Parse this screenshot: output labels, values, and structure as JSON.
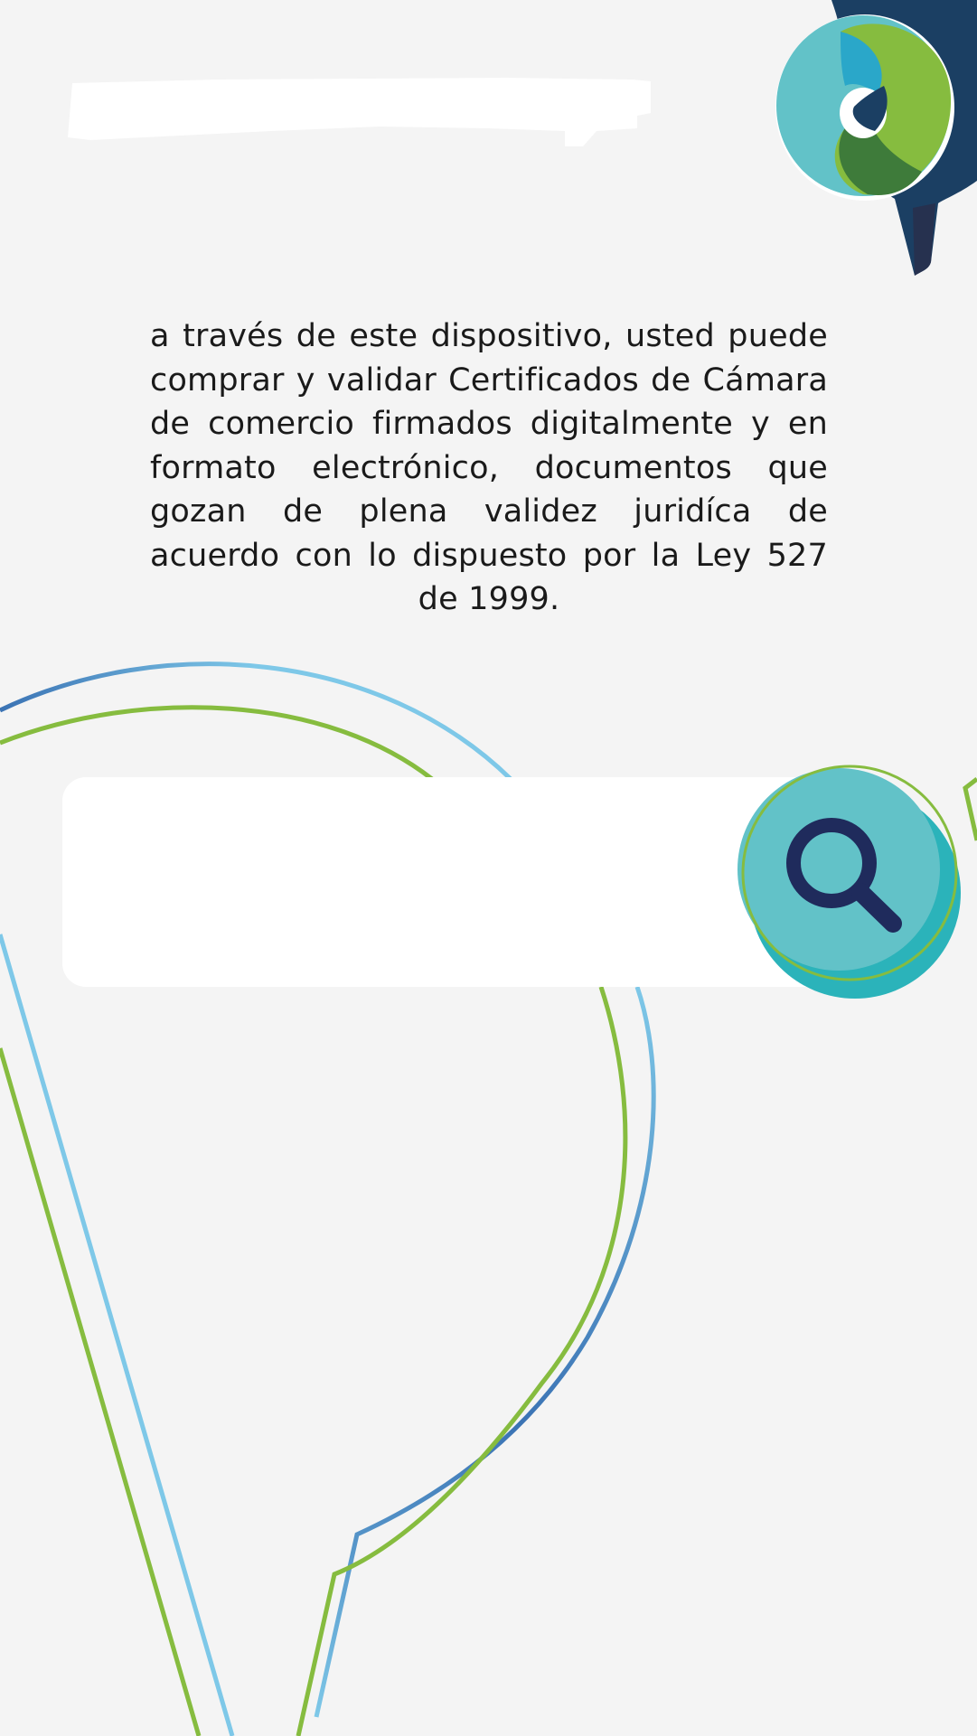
{
  "header": {
    "title": "",
    "logo_name": "brand-logo-icon"
  },
  "main": {
    "intro_text": "a través de este dispositivo, usted puede comprar y validar Certificados de Cámara de comercio firmados digitalmente y en formato electrónico, documentos que gozan de plena validez juridíca de acuerdo con lo dispuesto por la Ley 527 de 1999."
  },
  "search": {
    "value": "",
    "placeholder": "",
    "button_icon": "search-icon"
  },
  "colors": {
    "background": "#f4f4f4",
    "navy": "#1b2a4a",
    "teal": "#62c2c8",
    "teal_dark": "#2bb3ba",
    "green": "#86bc3f",
    "blue": "#3b73b4",
    "light_blue": "#7ec8e8",
    "text": "#1a1a1a"
  }
}
